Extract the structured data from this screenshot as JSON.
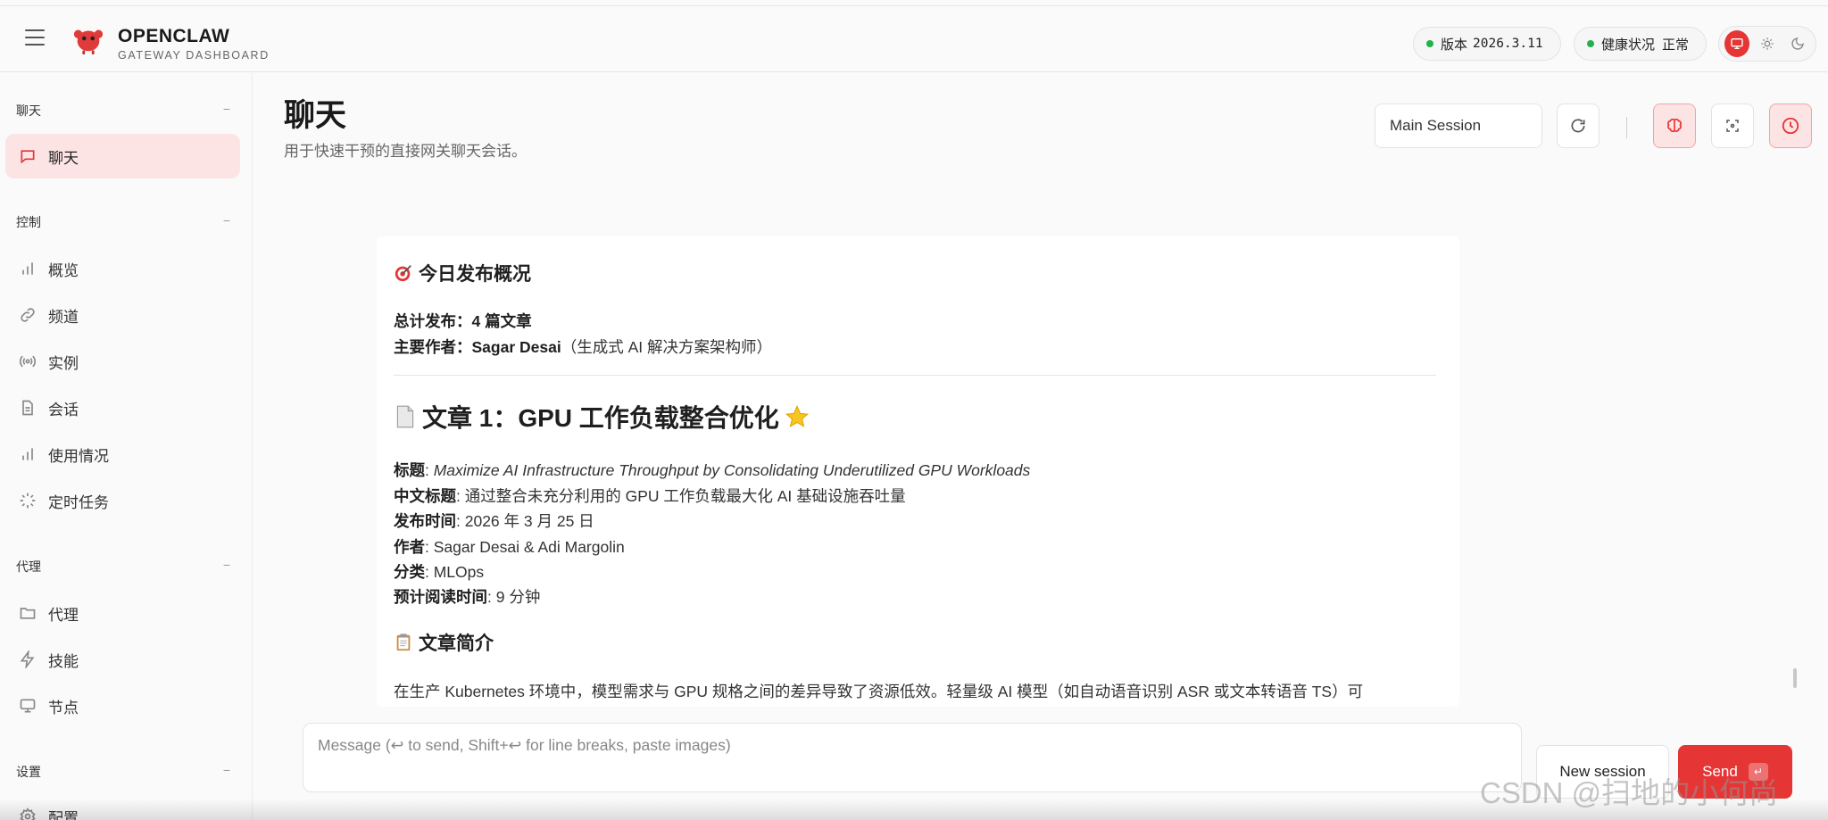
{
  "app": {
    "title": "OPENCLAW",
    "subtitle": "GATEWAY DASHBOARD"
  },
  "status": {
    "version_label": "版本",
    "version_value": "2026.3.11",
    "health_label": "健康状况",
    "health_value": "正常",
    "ok_color": "#22b14c"
  },
  "theme": {
    "accent": "#e53535",
    "modes": [
      "monitor-icon",
      "sun-icon",
      "moon-icon"
    ]
  },
  "sidebar": {
    "sections": [
      {
        "title": "聊天",
        "items": [
          {
            "label": "聊天",
            "icon": "chat-bubble-icon",
            "active": true
          }
        ]
      },
      {
        "title": "控制",
        "items": [
          {
            "label": "概览",
            "icon": "bar-chart-icon"
          },
          {
            "label": "频道",
            "icon": "link-icon"
          },
          {
            "label": "实例",
            "icon": "broadcast-icon"
          },
          {
            "label": "会话",
            "icon": "document-icon"
          },
          {
            "label": "使用情况",
            "icon": "bar-chart-icon"
          },
          {
            "label": "定时任务",
            "icon": "loader-icon"
          }
        ]
      },
      {
        "title": "代理",
        "items": [
          {
            "label": "代理",
            "icon": "folder-icon"
          },
          {
            "label": "技能",
            "icon": "lightning-icon"
          },
          {
            "label": "节点",
            "icon": "monitor-icon"
          }
        ]
      },
      {
        "title": "设置",
        "items": [
          {
            "label": "配置",
            "icon": "gear-icon"
          }
        ]
      }
    ],
    "collapse_glyph": "−"
  },
  "header": {
    "title": "聊天",
    "subtitle": "用于快速干预的直接网关聊天会话。",
    "session": "Main Session"
  },
  "message": {
    "heading1": "今日发布概况",
    "total_label": "总计发布：",
    "total_value": "4 篇文章",
    "author_label": "主要作者：",
    "author_value": "Sagar Desai",
    "author_role": "（生成式 AI 解决方案架构师）",
    "article_heading": "文章 1：GPU 工作负载整合优化",
    "fields": {
      "title_label": "标题",
      "title_value": "Maximize AI Infrastructure Throughput by Consolidating Underutilized GPU Workloads",
      "cn_title_label": "中文标题",
      "cn_title_value": "通过整合未充分利用的 GPU 工作负载最大化 AI 基础设施吞吐量",
      "date_label": "发布时间",
      "date_value": "2026 年 3 月 25 日",
      "author_label": "作者",
      "author_value": "Sagar Desai & Adi Margolin",
      "category_label": "分类",
      "category_value": "MLOps",
      "read_label": "预计阅读时间",
      "read_value": "9 分钟"
    },
    "summary_heading": "文章简介",
    "summary_text": "在生产 Kubernetes 环境中，模型需求与 GPU 规格之间的差异导致了资源低效。轻量级 AI 模型（如自动语音识别 ASR 或文本转语音 TS）可"
  },
  "composer": {
    "placeholder": "Message (↩ to send, Shift+↩ for line breaks, paste images)",
    "new_session": "New session",
    "send": "Send",
    "send_kbd": "↵"
  },
  "watermark": "CSDN @扫地的小何尚"
}
